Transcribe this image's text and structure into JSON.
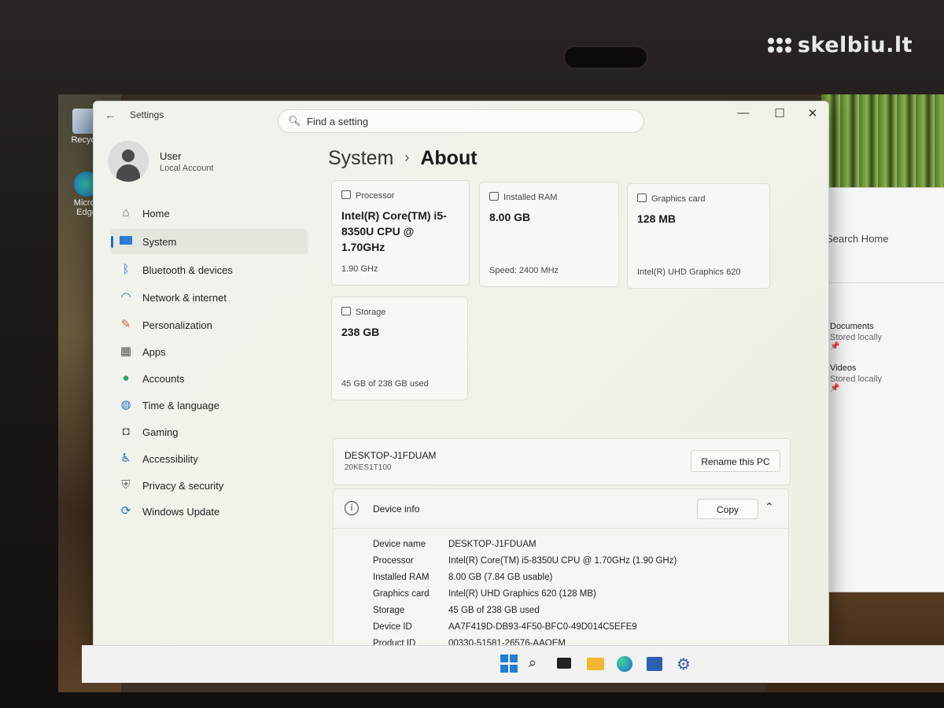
{
  "watermark": {
    "text": "skelbiu.lt"
  },
  "desktop": {
    "icons": [
      {
        "label": "Recycle"
      },
      {
        "label": "Micros Edge"
      }
    ]
  },
  "explorer": {
    "search_placeholder": "Search Home",
    "items": [
      {
        "name": "Documents",
        "sub": "Stored locally",
        "pin": "pin-icon"
      },
      {
        "name": "Videos",
        "sub": "Stored locally",
        "pin": "pin-icon"
      }
    ]
  },
  "settings": {
    "title": "Settings",
    "search_placeholder": "Find a setting",
    "user": {
      "name": "User",
      "account": "Local Account"
    },
    "nav": [
      {
        "label": "Home",
        "icon": "home-icon"
      },
      {
        "label": "System",
        "icon": "system-icon",
        "active": true
      },
      {
        "label": "Bluetooth & devices",
        "icon": "bluetooth-icon"
      },
      {
        "label": "Network & internet",
        "icon": "wifi-icon"
      },
      {
        "label": "Personalization",
        "icon": "brush-icon"
      },
      {
        "label": "Apps",
        "icon": "apps-icon"
      },
      {
        "label": "Accounts",
        "icon": "accounts-icon"
      },
      {
        "label": "Time & language",
        "icon": "globe-icon"
      },
      {
        "label": "Gaming",
        "icon": "gamepad-icon"
      },
      {
        "label": "Accessibility",
        "icon": "accessibility-icon"
      },
      {
        "label": "Privacy & security",
        "icon": "shield-icon"
      },
      {
        "label": "Windows Update",
        "icon": "update-icon"
      }
    ],
    "breadcrumb": {
      "parent": "System",
      "separator": "›",
      "current": "About"
    },
    "cards": {
      "processor": {
        "label": "Processor",
        "value": "Intel(R) Core(TM) i5-8350U CPU @ 1.70GHz",
        "foot": "1.90 GHz"
      },
      "ram": {
        "label": "Installed RAM",
        "value": "8.00 GB",
        "foot": "Speed: 2400 MHz"
      },
      "gpu": {
        "label": "Graphics card",
        "value": "128 MB",
        "foot": "Intel(R) UHD Graphics 620"
      },
      "storage": {
        "label": "Storage",
        "value": "238 GB",
        "foot": "45 GB of 238 GB used"
      }
    },
    "pc": {
      "name": "DESKTOP-J1FDUAM",
      "model": "20KES1T100",
      "rename_label": "Rename this PC"
    },
    "device_info": {
      "title": "Device info",
      "copy_label": "Copy",
      "rows": [
        {
          "k": "Device name",
          "v": "DESKTOP-J1FDUAM"
        },
        {
          "k": "Processor",
          "v": "Intel(R) Core(TM) i5-8350U CPU @ 1.70GHz (1.90 GHz)"
        },
        {
          "k": "Installed RAM",
          "v": "8.00 GB (7.84 GB usable)"
        },
        {
          "k": "Graphics card",
          "v": "Intel(R) UHD Graphics 620 (128 MB)"
        },
        {
          "k": "Storage",
          "v": "45 GB of 238 GB used"
        },
        {
          "k": "Device ID",
          "v": "AA7F419D-DB93-4F50-BFC0-49D014C5EFE9"
        },
        {
          "k": "Product ID",
          "v": "00330-51581-26576-AAOEM"
        }
      ]
    }
  },
  "taskbar": {
    "icons": [
      "start-icon",
      "search-icon",
      "task-view-icon",
      "file-explorer-icon",
      "edge-icon",
      "store-icon",
      "settings-icon"
    ]
  },
  "colors": {
    "accent": "#1f6fc9",
    "window_bg": "#f0f3ec",
    "card_bg": "#f7f8f4"
  }
}
